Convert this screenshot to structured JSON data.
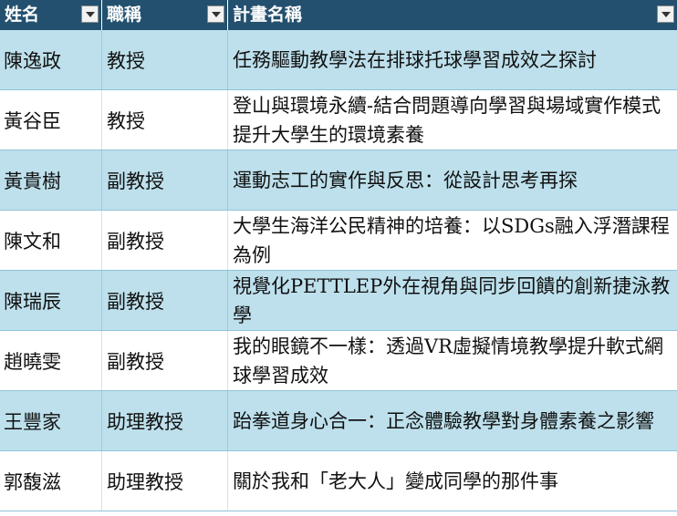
{
  "header": {
    "col_name": "姓名",
    "col_title": "職稱",
    "col_project": "計畫名稱"
  },
  "rows": [
    {
      "name": "陳逸政",
      "title": "教授",
      "project": "任務驅動教學法在排球托球學習成效之探討"
    },
    {
      "name": "黃谷臣",
      "title": "教授",
      "project": "登山與環境永續-結合問題導向學習與場域實作模式提升大學生的環境素養"
    },
    {
      "name": "黃貴樹",
      "title": "副教授",
      "project": "運動志工的實作與反思：從設計思考再探"
    },
    {
      "name": "陳文和",
      "title": "副教授",
      "project": "大學生海洋公民精神的培養：以SDGs融入浮潛課程為例"
    },
    {
      "name": "陳瑞辰",
      "title": "副教授",
      "project": "視覺化PETTLEP外在視角與同步回饋的創新捷泳教學"
    },
    {
      "name": "趙曉雯",
      "title": "副教授",
      "project": "我的眼鏡不一樣：透過VR虛擬情境教學提升軟式網球學習成效"
    },
    {
      "name": "王豐家",
      "title": "助理教授",
      "project": "跆拳道身心合一：正念體驗教學對身體素養之影響"
    },
    {
      "name": "郭馥滋",
      "title": "助理教授",
      "project": "關於我和「老大人」變成同學的那件事"
    }
  ],
  "colors": {
    "header_bg": "#23506e",
    "band_bg": "#bde0ec",
    "row_border": "#8fc3d9"
  }
}
